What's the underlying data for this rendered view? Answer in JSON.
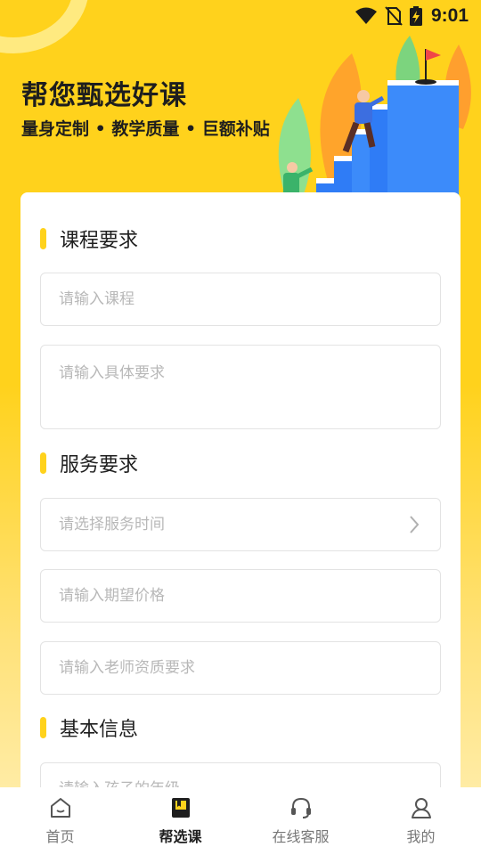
{
  "status_bar": {
    "time": "9:01"
  },
  "hero": {
    "title": "帮您甄选好课",
    "subtitle": "量身定制 • 教学质量 • 巨额补贴"
  },
  "sections": {
    "course": {
      "title": "课程要求"
    },
    "service": {
      "title": "服务要求"
    },
    "basic": {
      "title": "基本信息"
    }
  },
  "fields": {
    "course": {
      "placeholder": "请输入课程",
      "value": ""
    },
    "requirement": {
      "placeholder": "请输入具体要求",
      "value": ""
    },
    "service_time": {
      "placeholder": "请选择服务时间"
    },
    "price": {
      "placeholder": "请输入期望价格",
      "value": ""
    },
    "teacher": {
      "placeholder": "请输入老师资质要求",
      "value": ""
    },
    "grade": {
      "placeholder": "请输入孩子的年级",
      "value": ""
    }
  },
  "tabbar": {
    "items": [
      {
        "label": "首页",
        "icon": "home-icon"
      },
      {
        "label": "帮选课",
        "icon": "book-icon",
        "active": true
      },
      {
        "label": "在线客服",
        "icon": "headset-icon"
      },
      {
        "label": "我的",
        "icon": "user-icon"
      }
    ]
  },
  "colors": {
    "accent": "#FFD21C",
    "text": "#1e1e1e",
    "placeholder": "#b8b8b8"
  }
}
